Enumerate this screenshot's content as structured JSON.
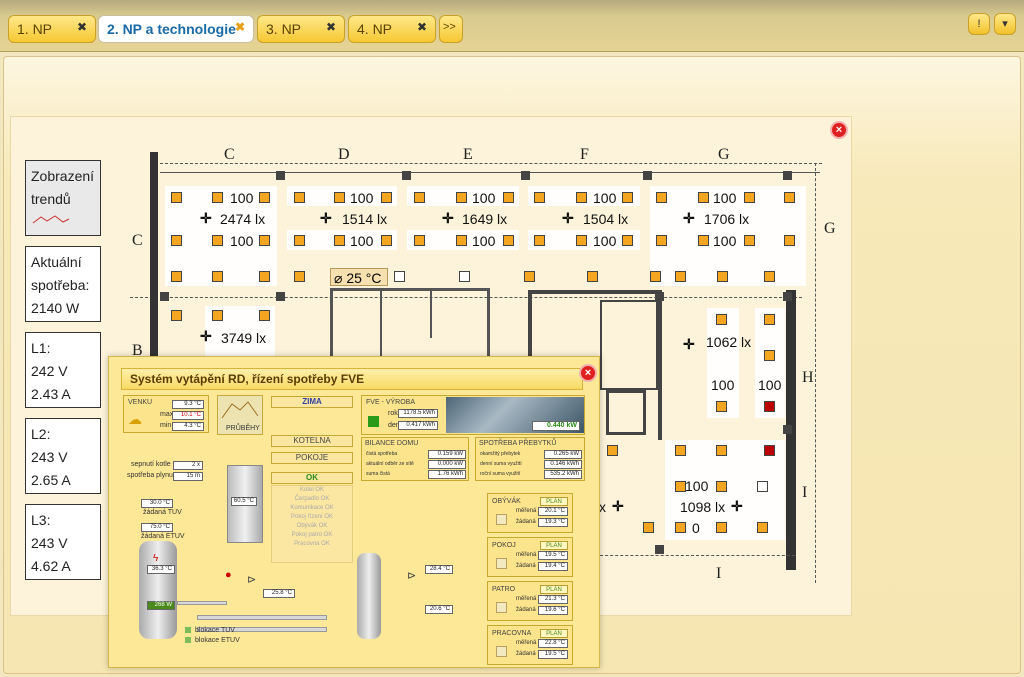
{
  "tabs": [
    {
      "label": "1. NP",
      "active": false
    },
    {
      "label": "2. NP a technologie",
      "active": true
    },
    {
      "label": "3. NP",
      "active": false
    },
    {
      "label": "4. NP",
      "active": false
    }
  ],
  "tab_more_label": ">>",
  "toolbar": {
    "warn_icon": "!",
    "menu_icon": "▾"
  },
  "plan": {
    "columns": [
      "C",
      "D",
      "E",
      "F",
      "G"
    ],
    "rows_left": [
      "C",
      "B"
    ],
    "rows_right": [
      "G",
      "H",
      "I"
    ],
    "bottom_label": "I",
    "values": {
      "row1": [
        "100",
        "100",
        "100",
        "100",
        "100"
      ],
      "row2": [
        "100",
        "100",
        "100",
        "100",
        "100"
      ],
      "lux1": [
        "2474 lx",
        "1514 lx",
        "1649 lx",
        "1504 lx",
        "1706 lx"
      ],
      "lux_left": "3749 lx",
      "lux_right": "1062 lx",
      "right_vals": [
        "100",
        "100"
      ],
      "bottom_val_1": "100",
      "bottom_lux": "1098 lx",
      "bottom_val_2": "0",
      "temp": "25 °C",
      "partial_x": "x"
    }
  },
  "side": {
    "trend_label_1": "Zobrazení",
    "trend_label_2": "trendů",
    "consumption_label": "Aktuální spotřeba:",
    "consumption_value": "2140 W",
    "phases": [
      {
        "name": "L1:",
        "voltage": "242 V",
        "current": "2.43 A"
      },
      {
        "name": "L2:",
        "voltage": "243 V",
        "current": "2.65 A"
      },
      {
        "name": "L3:",
        "voltage": "243 V",
        "current": "4.62 A"
      }
    ]
  },
  "popup": {
    "title": "Systém vytápění RD, řízení spotřeby FVE",
    "venku": {
      "label": "VENKU",
      "current": "9.3 °C",
      "max_label": "max",
      "max": "10.1 °C",
      "min_label": "min",
      "min": "4.3 °C"
    },
    "trend_label": "PRŮBĚHY",
    "mode": "ZIMA",
    "kotelna": "KOTELNA",
    "pokoje": "POKOJE",
    "ok": "OK",
    "status": [
      "Kotel OK",
      "Čerpadlo OK",
      "Komunikace OK",
      "Pokoj řízení OK",
      "Obývák OK",
      "Pokoj patro OK",
      "Pracovna OK"
    ],
    "sepnuti_label": "sepnutí kotle",
    "sepnuti": "2 x",
    "spotreba_plynu_label": "spotřeba plynu",
    "spotreba_plynu": "15 m",
    "boiler": {
      "tuv_temp": "30.0 °C",
      "zadana_tuv": "žádaná TUV",
      "etuv_temp": "75.0 °C",
      "zadana_etuv": "žádaná ETUV",
      "tank_temp": "36.3 °C",
      "tank_power": "268 W",
      "boiler_temp": "60.5 °C"
    },
    "pipe_temp_1": "25.8 °C",
    "pipe_temp_2": "28.4 °C",
    "pipe_temp_3": "20.6 °C",
    "blokace": [
      "blokace TUV",
      "blokace ETUV"
    ],
    "fve": {
      "label": "FVE - VÝROBA",
      "rok_label": "rok",
      "rok": "1178.5 kWh",
      "den_label": "den",
      "den": "0.417 kWh",
      "power": "0.440 kW"
    },
    "bilance": {
      "label": "BILANCE DOMU",
      "rows": [
        [
          "čistá spotřeba",
          "0.159 kW"
        ],
        [
          "aktuální odběr ze sítě",
          "0.000 kW"
        ],
        [
          "suma čistá",
          "1.76 kWh"
        ]
      ]
    },
    "prebytky": {
      "label": "SPOTŘEBA PŘEBYTKŮ",
      "rows": [
        [
          "okamžitý přebytek",
          "0.265 kW"
        ],
        [
          "denní suma využití",
          "0.146 kWh"
        ],
        [
          "roční suma využití",
          "535.2 kWh"
        ]
      ]
    },
    "rooms": [
      {
        "name": "OBÝVÁK",
        "plan": "PLÁN",
        "merena_label": "měřená",
        "merena": "20.1 °C",
        "zadana_label": "žádaná",
        "zadana": "19.3 °C"
      },
      {
        "name": "POKOJ",
        "plan": "PLÁN",
        "merena_label": "měřená",
        "merena": "19.5 °C",
        "zadana_label": "žádaná",
        "zadana": "19.4 °C"
      },
      {
        "name": "PATRO",
        "plan": "PLÁN",
        "merena_label": "měřená",
        "merena": "21.3 °C",
        "zadana_label": "žádaná",
        "zadana": "19.6 °C"
      },
      {
        "name": "PRACOVNA",
        "plan": "PLÁN",
        "merena_label": "měřená",
        "merena": "22.8 °C",
        "zadana_label": "žádaná",
        "zadana": "19.5 °C"
      }
    ]
  },
  "colors": {
    "accent": "#f6c832",
    "lamp_on": "#f5a620",
    "alarm": "#b00000",
    "fve_green": "#2a8a1a"
  }
}
